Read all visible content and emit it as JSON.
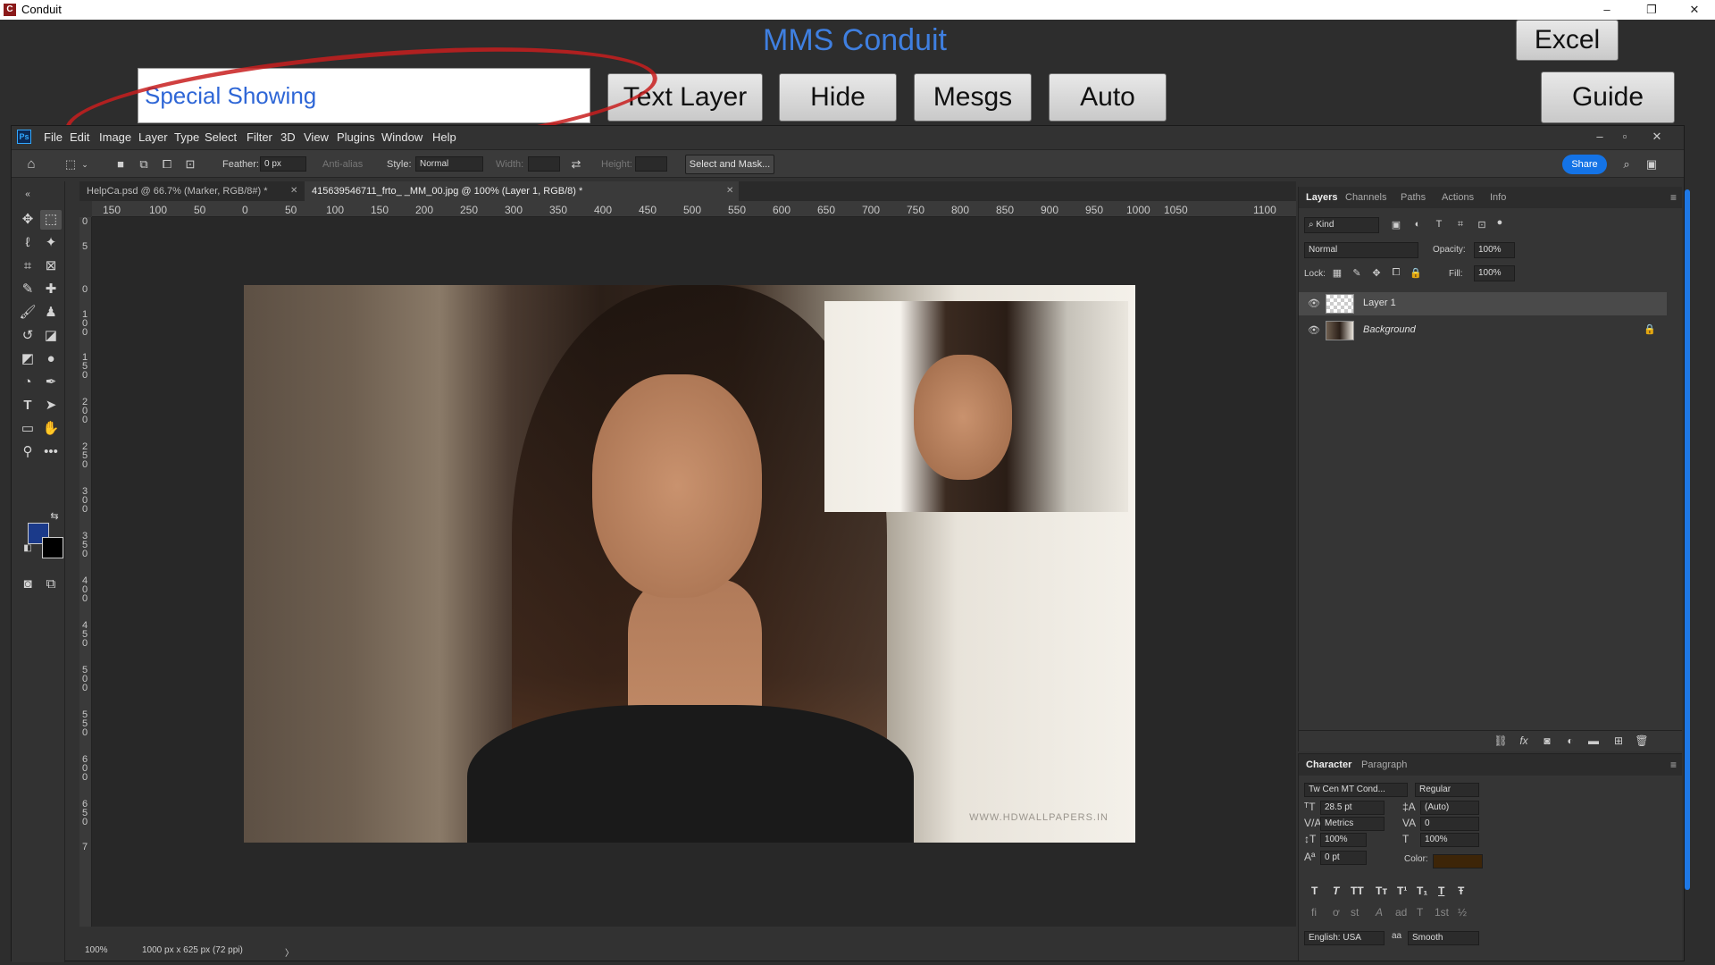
{
  "window": {
    "title": "Conduit",
    "app_icon": "conduit-app-icon",
    "minimize": "–",
    "restore": "❐",
    "close": "✕"
  },
  "conduit": {
    "heading": "MMS Conduit",
    "input_value": "Special Showing",
    "buttons": {
      "text_layer": "Text Layer",
      "hide": "Hide",
      "mesgs": "Mesgs",
      "auto": "Auto",
      "excel": "Excel",
      "guide": "Guide"
    }
  },
  "ps": {
    "logo": "Ps",
    "menu": [
      "File",
      "Edit",
      "Image",
      "Layer",
      "Type",
      "Select",
      "Filter",
      "3D",
      "View",
      "Plugins",
      "Window",
      "Help"
    ],
    "options": {
      "feather_label": "Feather:",
      "feather_value": "0 px",
      "antialias_label": "Anti-alias",
      "style_label": "Style:",
      "style_value": "Normal",
      "width_label": "Width:",
      "height_label": "Height:",
      "select_mask": "Select and Mask...",
      "share": "Share"
    },
    "tabs": [
      {
        "label": "HelpCa.psd @ 66.7% (Marker, RGB/8#) *"
      },
      {
        "label": "415639546711_frto_                              _MM_00.jpg @ 100% (Layer 1, RGB/8) *"
      }
    ],
    "ruler_h": [
      "150",
      "100",
      "50",
      "0",
      "50",
      "100",
      "150",
      "200",
      "250",
      "300",
      "350",
      "400",
      "450",
      "500",
      "550",
      "600",
      "650",
      "700",
      "750",
      "800",
      "850",
      "900",
      "950",
      "1000",
      "1050",
      "1100"
    ],
    "ruler_v": [
      "0",
      "5",
      "0",
      "1 0 0",
      "1 5 0",
      "2 0 0",
      "2 5 0",
      "3 0 0",
      "3 5 0",
      "4 0 0",
      "4 5 0",
      "5 0 0",
      "5 5 0",
      "6 0 0",
      "6 5 0",
      "7"
    ],
    "watermark": "WWW.HDWALLPAPERS.IN",
    "status": {
      "zoom": "100%",
      "doc_size": "1000 px x 625 px (72 ppi)",
      "arrow": "〉"
    }
  },
  "layers_panel": {
    "tabs": [
      "Layers",
      "Channels",
      "Paths",
      "Actions",
      "Info"
    ],
    "kind": "Kind",
    "blend_mode": "Normal",
    "opacity_label": "Opacity:",
    "opacity_value": "100%",
    "lock_label": "Lock:",
    "fill_label": "Fill:",
    "fill_value": "100%",
    "layers": [
      {
        "name": "Layer 1"
      },
      {
        "name": "Background"
      }
    ]
  },
  "char_panel": {
    "tabs": [
      "Character",
      "Paragraph"
    ],
    "font_family": "Tw Cen MT Cond...",
    "font_style": "Regular",
    "font_size": "28.5 pt",
    "leading": "(Auto)",
    "kerning": "Metrics",
    "tracking": "0",
    "vscale": "100%",
    "hscale": "100%",
    "baseline": "0 pt",
    "color_label": "Color:",
    "color_value": "#3d2508",
    "type_buttons": [
      "T",
      "T",
      "TT",
      "Tт",
      "T¹",
      "T₁",
      "T",
      "Ŧ"
    ],
    "ot_buttons": [
      "fi",
      "ơ",
      "st",
      "A",
      "ad",
      "T",
      "1st",
      "½"
    ],
    "language": "English: USA",
    "aa_icon": "aa",
    "antialias": "Smooth"
  }
}
